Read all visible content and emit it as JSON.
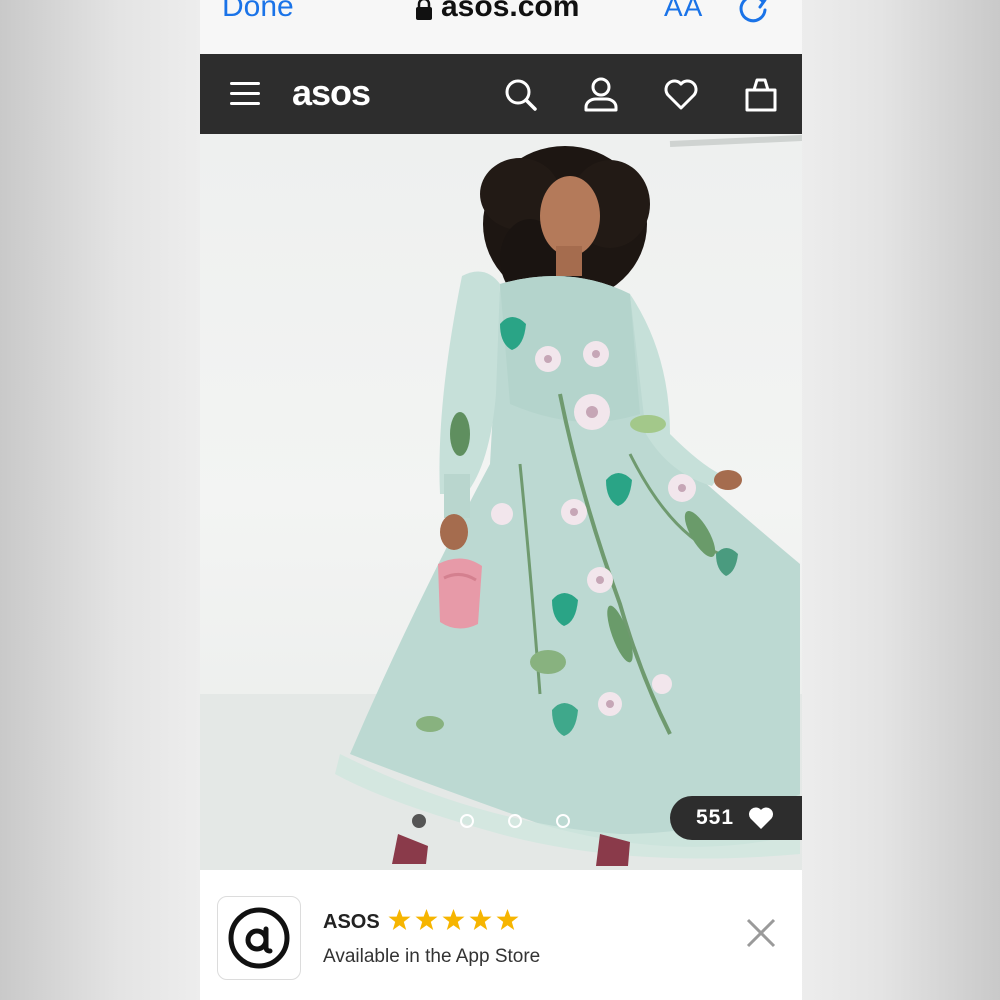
{
  "browser": {
    "done_label": "Done",
    "url": "asos.com",
    "text_size_label": "AA"
  },
  "header": {
    "logo_text": "asos"
  },
  "product": {
    "likes_count": "551",
    "image_count": 4,
    "active_image": 1
  },
  "app_banner": {
    "name": "ASOS",
    "rating_stars": 5,
    "subtitle": "Available in the App Store"
  },
  "colors": {
    "header_bg": "#2d2d2d",
    "link_blue": "#1a73e8",
    "star_gold": "#f6b500",
    "dress_mint": "#bcd9d2"
  }
}
